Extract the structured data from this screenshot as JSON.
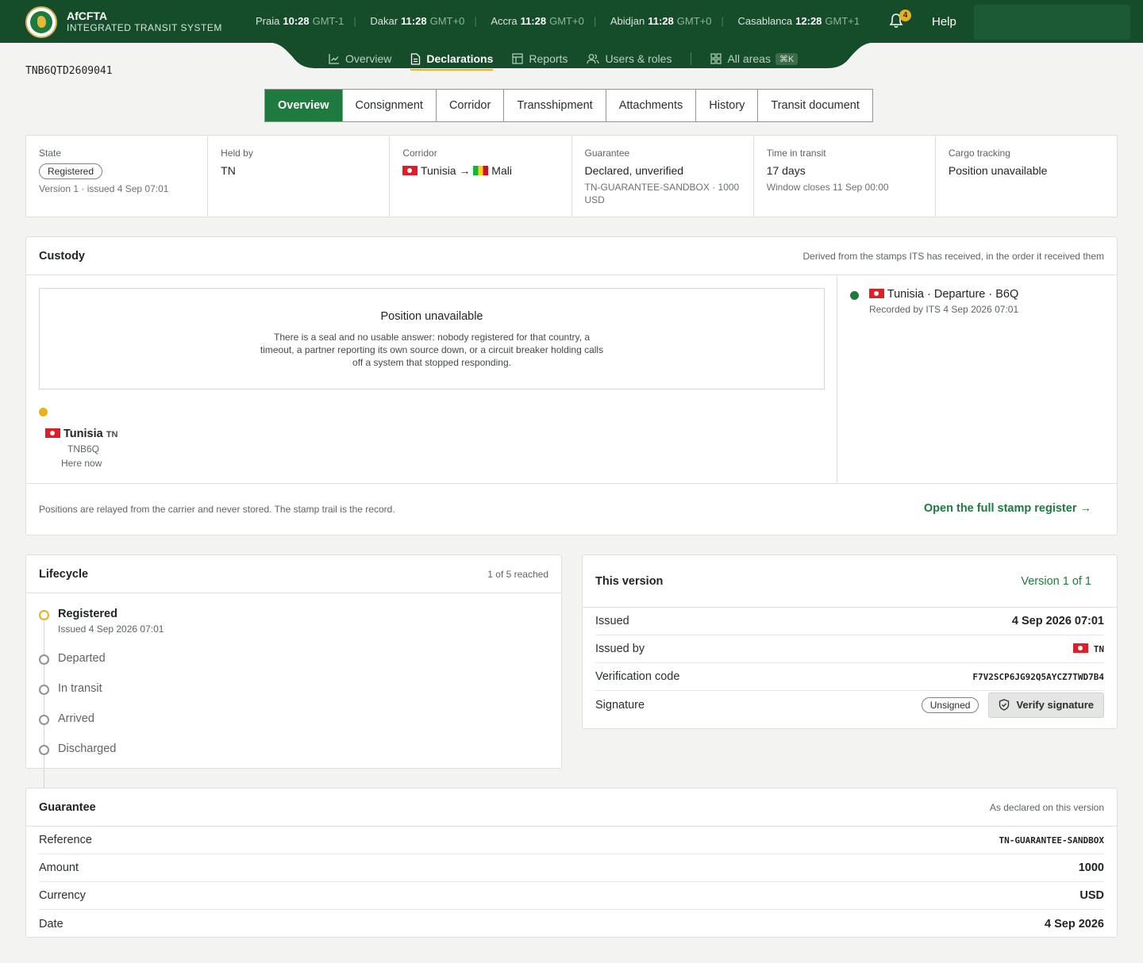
{
  "header": {
    "brand_name": "AfCFTA",
    "brand_sub": "INTEGRATED TRANSIT SYSTEM",
    "clocks": [
      {
        "city": "Praia",
        "time": "10:28",
        "tz": "GMT-1"
      },
      {
        "city": "Dakar",
        "time": "11:28",
        "tz": "GMT+0"
      },
      {
        "city": "Accra",
        "time": "11:28",
        "tz": "GMT+0"
      },
      {
        "city": "Abidjan",
        "time": "11:28",
        "tz": "GMT+0"
      },
      {
        "city": "Casablanca",
        "time": "12:28",
        "tz": "GMT+1"
      }
    ],
    "notification_count": "4",
    "help_label": "Help"
  },
  "nav": {
    "items": [
      {
        "label": "Overview",
        "icon": "chart-line-icon"
      },
      {
        "label": "Declarations",
        "icon": "document-icon"
      },
      {
        "label": "Reports",
        "icon": "table-icon"
      },
      {
        "label": "Users & roles",
        "icon": "users-icon"
      }
    ],
    "all_areas": "All areas",
    "shortcut": "⌘K"
  },
  "declaration_id": "TNB6QTD2609041",
  "subtabs": [
    "Overview",
    "Consignment",
    "Corridor",
    "Transshipment",
    "Attachments",
    "History",
    "Transit document"
  ],
  "summary": {
    "state": {
      "label": "State",
      "value": "Registered",
      "sub": "Version 1 · issued 4 Sep 07:01"
    },
    "held_by": {
      "label": "Held by",
      "value": "TN"
    },
    "corridor": {
      "label": "Corridor",
      "from": "Tunisia",
      "arrow": "→",
      "to": "Mali"
    },
    "guarantee": {
      "label": "Guarantee",
      "value": "Declared, unverified",
      "sub": "TN-GUARANTEE-SANDBOX · 1000 USD"
    },
    "time_in_transit": {
      "label": "Time in transit",
      "value": "17 days",
      "sub": "Window closes 11 Sep 00:00"
    },
    "cargo_tracking": {
      "label": "Cargo tracking",
      "value": "Position unavailable"
    }
  },
  "custody": {
    "title": "Custody",
    "note": "Derived from the stamps ITS has received, in the order it received them",
    "position_title": "Position unavailable",
    "position_text": "There is a seal and no usable answer: nobody registered for that country, a timeout, a partner reporting its own source down, or a circuit breaker holding calls off a system that stopped responding.",
    "location": {
      "country": "Tunisia",
      "code": "TN",
      "office": "TNB6Q",
      "status": "Here now"
    },
    "stamp": {
      "title": "Tunisia · Departure · B6Q",
      "sub": "Recorded by ITS 4 Sep 2026 07:01"
    },
    "footer_note": "Positions are relayed from the carrier and never stored. The stamp trail is the record.",
    "footer_link": "Open the full stamp register →"
  },
  "lifecycle": {
    "title": "Lifecycle",
    "progress": "1 of 5 reached",
    "steps": [
      {
        "label": "Registered",
        "sub": "Issued 4 Sep 2026 07:01"
      },
      {
        "label": "Departed"
      },
      {
        "label": "In transit"
      },
      {
        "label": "Arrived"
      },
      {
        "label": "Discharged"
      }
    ]
  },
  "version": {
    "title": "This version",
    "link": "Version 1 of 1",
    "issued_label": "Issued",
    "issued_value": "4 Sep 2026 07:01",
    "issued_by_label": "Issued by",
    "issued_by_value": "TN",
    "code_label": "Verification code",
    "code_value": "F7V2SCP6JG92Q5AYCZ7TWD7B4",
    "signature_label": "Signature",
    "signature_status": "Unsigned",
    "verify_label": "Verify signature"
  },
  "guarantee": {
    "title": "Guarantee",
    "note": "As declared on this version",
    "rows": [
      {
        "k": "Reference",
        "v": "TN-GUARANTEE-SANDBOX"
      },
      {
        "k": "Amount",
        "v": "1000"
      },
      {
        "k": "Currency",
        "v": "USD"
      },
      {
        "k": "Date",
        "v": "4 Sep 2026"
      }
    ]
  },
  "colors": {
    "brand_green": "#154d2b",
    "accent_green": "#1e7a3f",
    "accent_yellow": "#e9b020"
  }
}
